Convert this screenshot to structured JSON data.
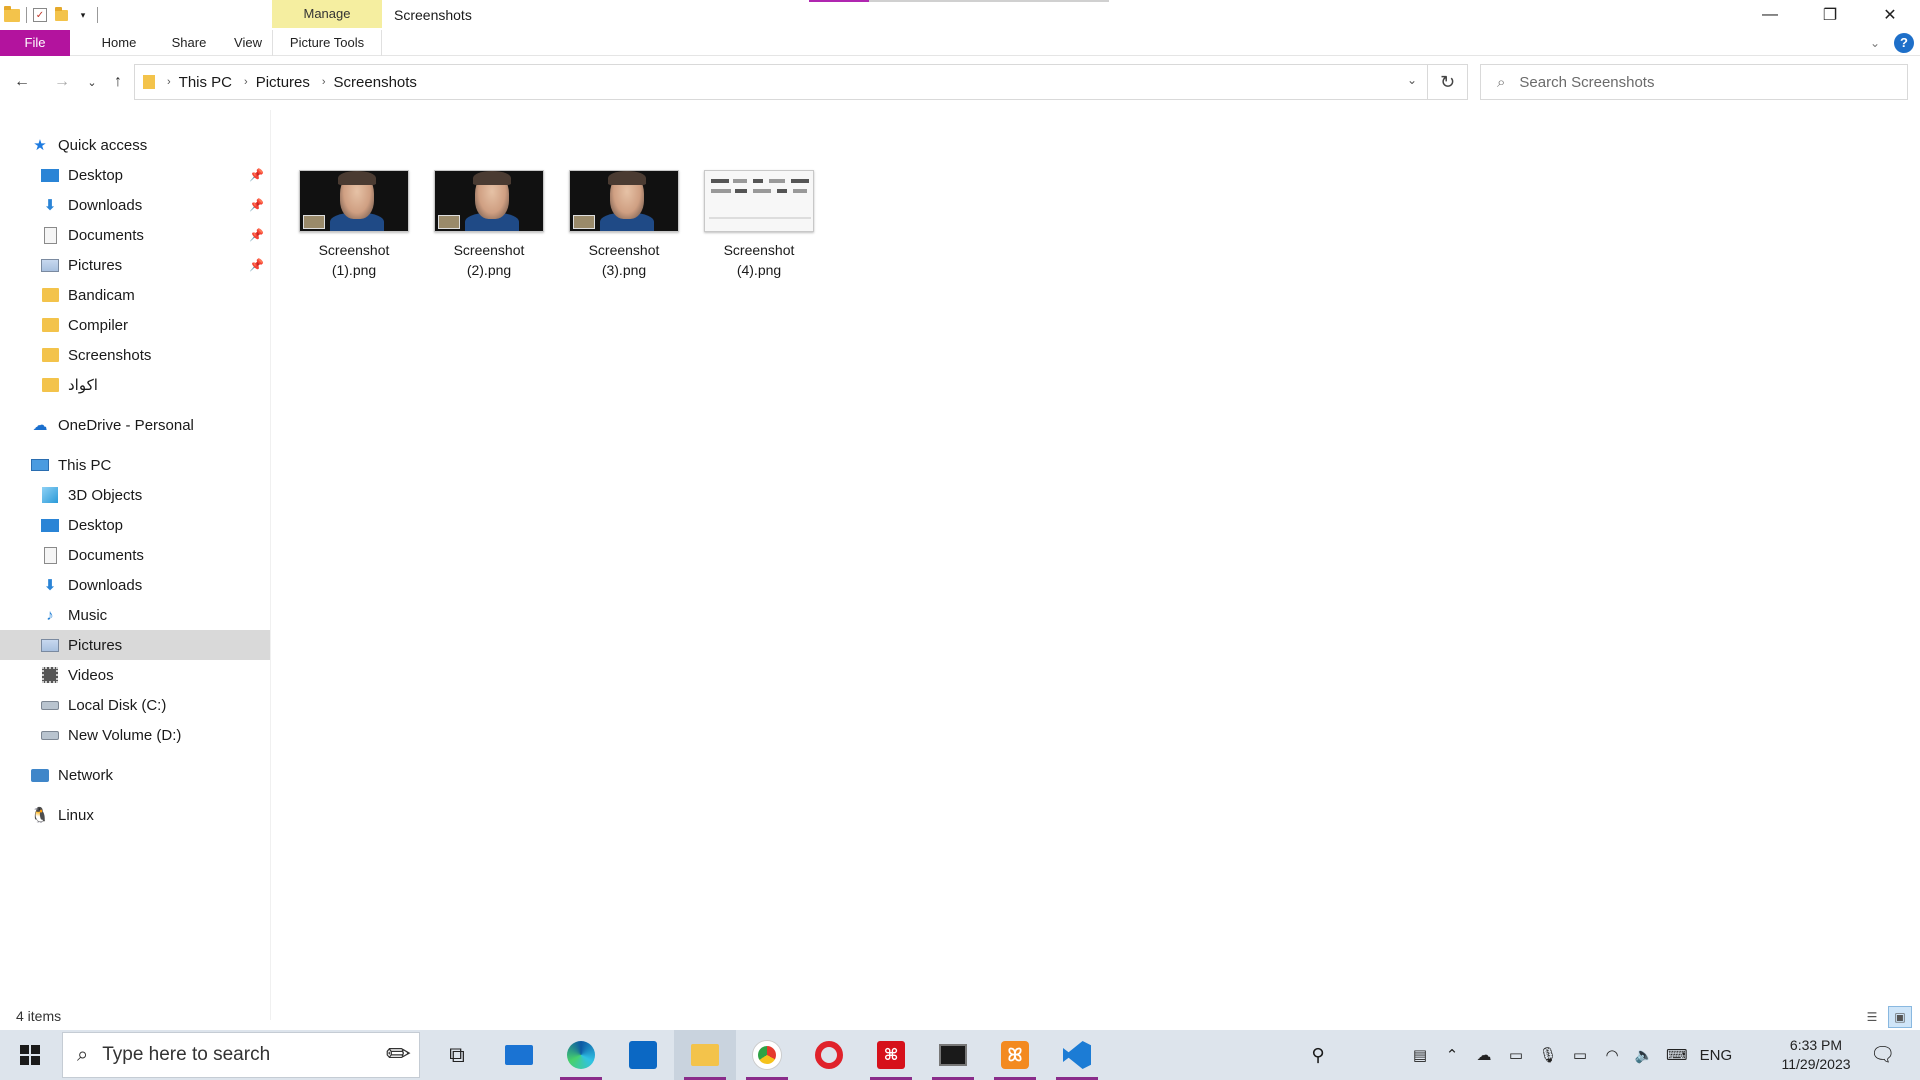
{
  "window": {
    "title": "Screenshots",
    "manage_tab": "Manage",
    "controls": {
      "minimize": "—",
      "maximize": "❐",
      "close": "✕"
    }
  },
  "ribbon": {
    "tabs": [
      {
        "label": "File"
      },
      {
        "label": "Home"
      },
      {
        "label": "Share"
      },
      {
        "label": "View"
      },
      {
        "label": "Picture Tools"
      }
    ],
    "help": "?"
  },
  "address": {
    "crumbs": [
      "This PC",
      "Pictures",
      "Screenshots"
    ],
    "search_placeholder": "Search Screenshots"
  },
  "sidebar": {
    "items": [
      {
        "label": "Quick access",
        "icon": "star-icon"
      },
      {
        "label": "Desktop",
        "icon": "desktop-icon",
        "pinned": true
      },
      {
        "label": "Downloads",
        "icon": "download-icon",
        "pinned": true
      },
      {
        "label": "Documents",
        "icon": "documents-icon",
        "pinned": true
      },
      {
        "label": "Pictures",
        "icon": "pictures-icon",
        "pinned": true
      },
      {
        "label": "Bandicam",
        "icon": "folder-icon"
      },
      {
        "label": "Compiler",
        "icon": "folder-icon"
      },
      {
        "label": "Screenshots",
        "icon": "folder-icon"
      },
      {
        "label": "اكواد",
        "icon": "folder-icon"
      },
      {
        "label": "OneDrive - Personal",
        "icon": "onedrive-icon"
      },
      {
        "label": "This PC",
        "icon": "computer-icon"
      },
      {
        "label": "3D Objects",
        "icon": "3d-objects-icon"
      },
      {
        "label": "Desktop",
        "icon": "desktop-icon"
      },
      {
        "label": "Documents",
        "icon": "documents-icon"
      },
      {
        "label": "Downloads",
        "icon": "download-icon"
      },
      {
        "label": "Music",
        "icon": "music-icon"
      },
      {
        "label": "Pictures",
        "icon": "pictures-icon",
        "selected": true
      },
      {
        "label": "Videos",
        "icon": "videos-icon"
      },
      {
        "label": "Local Disk (C:)",
        "icon": "drive-icon"
      },
      {
        "label": "New Volume (D:)",
        "icon": "drive-icon"
      },
      {
        "label": "Network",
        "icon": "network-icon"
      },
      {
        "label": "Linux",
        "icon": "linux-icon"
      }
    ]
  },
  "files": [
    {
      "line1": "Screenshot",
      "line2": "(1).png"
    },
    {
      "line1": "Screenshot",
      "line2": "(2).png"
    },
    {
      "line1": "Screenshot",
      "line2": "(3).png"
    },
    {
      "line1": "Screenshot",
      "line2": "(4).png"
    }
  ],
  "status": {
    "count": "4 items"
  },
  "taskbar": {
    "search_placeholder": "Type here to search",
    "apps": [
      "task-view-icon",
      "mail-icon",
      "edge-icon",
      "store-icon",
      "file-explorer-icon",
      "chrome-icon",
      "opera-icon",
      "acrobat-icon",
      "terminal-icon",
      "xampp-icon",
      "vscode-icon"
    ],
    "tray": {
      "language": "ENG"
    },
    "clock": {
      "time": "6:33 PM",
      "date": "11/29/2023"
    }
  },
  "colors": {
    "file_tab": "#b3139e",
    "manage_tab": "#f5eea0",
    "selection": "#d9d9d9",
    "taskbar": "#dde4ec",
    "accent": "#1e6fc9"
  }
}
